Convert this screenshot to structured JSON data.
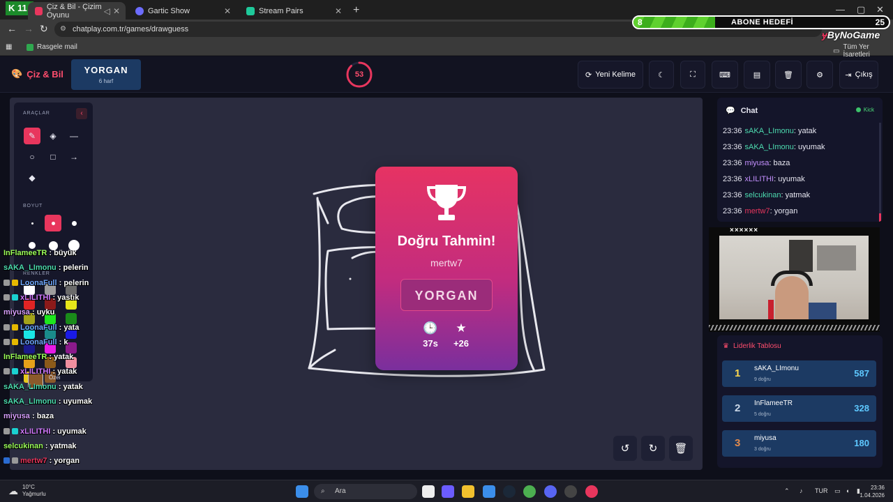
{
  "app_badge": "11",
  "tabs": [
    {
      "title": "Çiz & Bil - Çizim Oyunu",
      "active": true
    },
    {
      "title": "Gartic Show",
      "active": false
    },
    {
      "title": "Stream Pairs",
      "active": false
    }
  ],
  "address": "chatplay.com.tr/games/drawguess",
  "bookmarks": {
    "left": "Rasgele mail",
    "right": "Tüm Yer İşaretleri"
  },
  "goal": {
    "current": "8",
    "title": "ABONE HEDEFİ",
    "target": "25",
    "progress": 0.32
  },
  "brand_overlay": "ByNoGame",
  "header": {
    "brand": "Çiz & Bil",
    "word": "YORGAN",
    "hint": "6 harf",
    "timer": "53",
    "timer_progress": 0.88,
    "buttons": {
      "new_word": "Yeni Kelime",
      "exit": "Çıkış"
    }
  },
  "tools": {
    "tools_label": "ARAÇLAR",
    "size_label": "BOYUT",
    "colors_label": "RENKLER",
    "custom_label": "Özel",
    "colors": [
      "#ffffff",
      "#9e9e9e",
      "#6b6b6b",
      "#e02424",
      "#8b1a1a",
      "#e6e61a",
      "#a3a31a",
      "#1ee61e",
      "#1a8b1a",
      "#1ae6e6",
      "#1a8b8b",
      "#1a1ae6",
      "#1a1a8b",
      "#e61ae6",
      "#8b1a8b",
      "#e6a01a",
      "#8b5a1a",
      "#f08fa0",
      "#e6c81a",
      "#8b5a2b"
    ]
  },
  "modal": {
    "title": "Doğru Tahmin!",
    "player": "mertw7",
    "answer": "YORGAN",
    "time": "37s",
    "points": "+26"
  },
  "chat": {
    "title": "Chat",
    "platform": "Kick",
    "messages": [
      {
        "time": "23:36",
        "user": "sAKA_LImonu",
        "text": ": yatak",
        "color": "#4ddcb0"
      },
      {
        "time": "23:36",
        "user": "sAKA_LImonu",
        "text": ": uyumak",
        "color": "#4ddcb0"
      },
      {
        "time": "23:36",
        "user": "miyusa",
        "text": ": baza",
        "color": "#c490ff"
      },
      {
        "time": "23:36",
        "user": "xLILITHI",
        "text": ": uyumak",
        "color": "#c490ff"
      },
      {
        "time": "23:36",
        "user": "selcukinan",
        "text": ": yatmak",
        "color": "#4ddcb0"
      },
      {
        "time": "23:36",
        "user": "mertw7",
        "text": ": yorgan",
        "color": "#e8365d"
      }
    ]
  },
  "webcam_tape": "××××××",
  "leaderboard": {
    "title": "Liderlik Tablosu",
    "rows": [
      {
        "rank": "1",
        "name": "sAKA_LImonu",
        "sub": "9 doğru",
        "score": "587",
        "rank_color": "#ffd84d"
      },
      {
        "rank": "2",
        "name": "InFlameeTR",
        "sub": "5 doğru",
        "score": "328",
        "rank_color": "#c9d6e6"
      },
      {
        "rank": "3",
        "name": "miyusa",
        "sub": "3 doğru",
        "score": "180",
        "rank_color": "#e08a4d"
      }
    ]
  },
  "overlay_chat": [
    {
      "user": "InFlameeTR",
      "text": " : büyük",
      "color": "#9cff5a",
      "badges": []
    },
    {
      "user": "sAKA_LImonu",
      "text": " : pelerin",
      "color": "#4ddcb0",
      "badges": []
    },
    {
      "user": "LoonaFull",
      "text": " : pelerin",
      "color": "#6fa8ff",
      "badges": [
        "#999",
        "#e6b800"
      ]
    },
    {
      "user": "xLILITHI",
      "text": " : yastık",
      "color": "#d27aff",
      "badges": [
        "#999",
        "#1ad1d1"
      ]
    },
    {
      "user": "miyusa",
      "text": " : uyku",
      "color": "#d8a0ff",
      "badges": []
    },
    {
      "user": "LoonaFull",
      "text": " : yata",
      "color": "#6fa8ff",
      "badges": [
        "#999",
        "#e6b800"
      ]
    },
    {
      "user": "LoonaFull",
      "text": " : k",
      "color": "#6fa8ff",
      "badges": [
        "#999",
        "#e6b800"
      ]
    },
    {
      "user": "InFlameeTR",
      "text": " : yatak",
      "color": "#9cff5a",
      "badges": []
    },
    {
      "user": "xLILITHI",
      "text": " : yatak",
      "color": "#d27aff",
      "badges": [
        "#999",
        "#1ad1d1"
      ]
    },
    {
      "user": "sAKA_LImonu",
      "text": " : yatak",
      "color": "#4ddcb0",
      "badges": []
    },
    {
      "user": "sAKA_LImonu",
      "text": " : uyumak",
      "color": "#4ddcb0",
      "badges": []
    },
    {
      "user": "miyusa",
      "text": " : baza",
      "color": "#d8a0ff",
      "badges": []
    },
    {
      "user": "xLILITHI",
      "text": " : uyumak",
      "color": "#d27aff",
      "badges": [
        "#999",
        "#1ad1d1"
      ]
    },
    {
      "user": "selcukinan",
      "text": " : yatmak",
      "color": "#9cff5a",
      "badges": []
    },
    {
      "user": "mertw7",
      "text": " : yorgan",
      "color": "#e8365d",
      "badges": [
        "#2a6bd1",
        "#999"
      ]
    }
  ],
  "taskbar": {
    "temp": "10°C",
    "weather": "Yağmurlu",
    "search": "Ara",
    "lang": "TUR",
    "time": "23:36",
    "date": "1.04.2026"
  }
}
